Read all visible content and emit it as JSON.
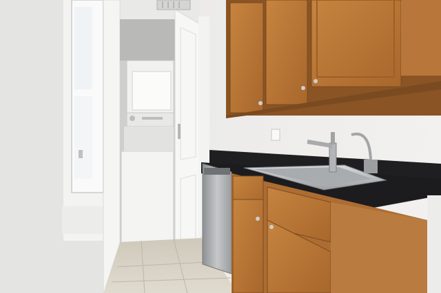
{
  "photo": {
    "subject": "",
    "colors": {
      "wall": "#ecebe9",
      "wall_shadow": "#d9d8d4",
      "cabinet_wood": "#b8763a",
      "cabinet_dark": "#8a5424",
      "countertop": "#1c1c1e",
      "stainless": "#b9bbbd",
      "appliance_white": "#f4f4f2",
      "floor_tile": "#dad4c6",
      "door_white": "#f7f7f5"
    }
  }
}
